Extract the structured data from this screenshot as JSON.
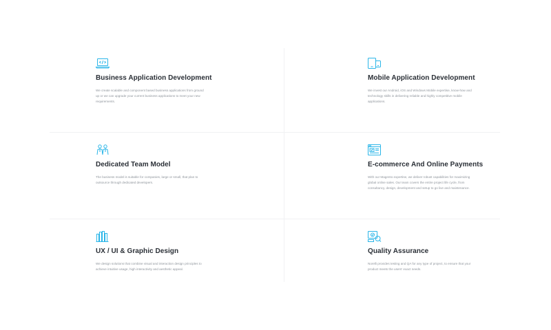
{
  "colors": {
    "accent": "#29b5e8",
    "title": "#2a2f36",
    "text": "#8f959c",
    "divider": "#f0f1f3"
  },
  "services": [
    {
      "icon": "laptop-code-icon",
      "title": "Business Application Development",
      "description": "We create scalable and component based business applications from ground up or we can upgrade your current business applications to meet your new requirements."
    },
    {
      "icon": "mobile-device-icon",
      "title": "Mobile Application Development",
      "description": "We invest our Android, iOS and Windows Mobile expertise, know-how and technology skills in delivering reliable and highly competitive mobile applications."
    },
    {
      "icon": "team-people-icon",
      "title": "Dedicated Team Model",
      "description": "The business model is suitable for companies, large or small, that plan to outsource through dedicated developers."
    },
    {
      "icon": "online-store-icon",
      "title": "E-commerce And Online Payments",
      "description": "With our Magento expertise, we deliver robust capabilities for maximizing global online sales. Our team covers the entire project life cycle, from consultancy, design, development and setup to go live and maintenance."
    },
    {
      "icon": "design-tools-icon",
      "title": "UX / UI & Graphic Design",
      "description": "We design solutions that combine visual and interaction design principles to achieve intuitive usage, high interactivity and aesthetic appeal."
    },
    {
      "icon": "quality-check-icon",
      "title": "Quality Assurance",
      "description": "Norelli provides testing and QA for any type of project, to ensure that your product meets the users' exact needs."
    }
  ]
}
